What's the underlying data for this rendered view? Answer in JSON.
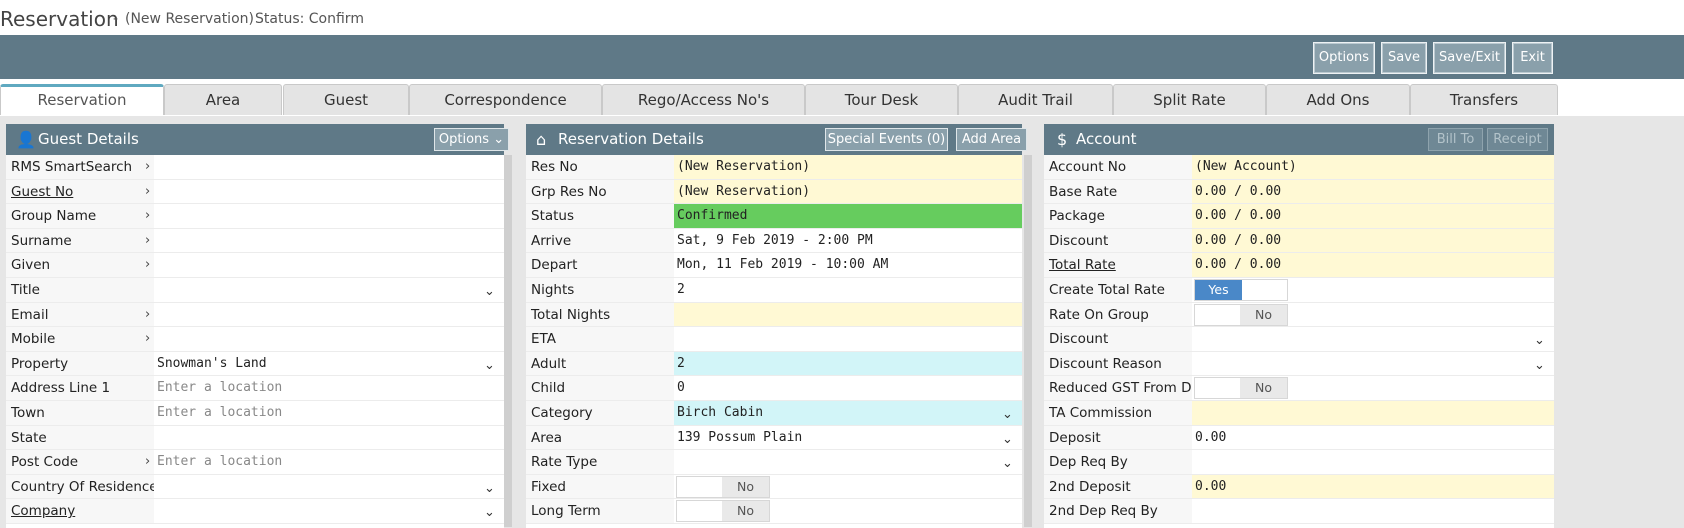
{
  "header": {
    "title": "Reservation",
    "dash": "-",
    "subtitle": "(New Reservation)",
    "status": "Status: Confirm"
  },
  "toolbar": {
    "options": "Options",
    "save": "Save",
    "save_exit": "Save/Exit",
    "exit": "Exit"
  },
  "tabs": [
    "Reservation",
    "Area",
    "Guest",
    "Correspondence",
    "Rego/Access No's",
    "Tour Desk",
    "Audit Trail",
    "Split Rate",
    "Add Ons",
    "Transfers"
  ],
  "guest": {
    "title": "Guest Details",
    "options_label": "Options ⌄",
    "rows": [
      {
        "label": "RMS SmartSearch",
        "value": ""
      },
      {
        "label": "Guest No",
        "value": ""
      },
      {
        "label": "Group Name",
        "value": ""
      },
      {
        "label": "Surname",
        "value": ""
      },
      {
        "label": "Given",
        "value": ""
      },
      {
        "label": "Title",
        "value": ""
      },
      {
        "label": "Email",
        "value": ""
      },
      {
        "label": "Mobile",
        "value": ""
      },
      {
        "label": "Property",
        "value": "Snowman's Land"
      },
      {
        "label": "Address Line 1",
        "value": "Enter a location"
      },
      {
        "label": "Town",
        "value": "Enter a location"
      },
      {
        "label": "State",
        "value": ""
      },
      {
        "label": "Post Code",
        "value": "Enter a location"
      },
      {
        "label": "Country Of Residence",
        "value": ""
      },
      {
        "label": "Company",
        "value": ""
      }
    ]
  },
  "reservation": {
    "title": "Reservation Details",
    "special_events": "Special Events (0)",
    "add_area": "Add Area",
    "rows": [
      {
        "label": "Res No",
        "value": "(New Reservation)"
      },
      {
        "label": "Grp Res No",
        "value": "(New Reservation)"
      },
      {
        "label": "Status",
        "value": "Confirmed"
      },
      {
        "label": "Arrive",
        "value": "Sat, 9 Feb 2019 - 2:00 PM"
      },
      {
        "label": "Depart",
        "value": "Mon, 11 Feb 2019 - 10:00 AM"
      },
      {
        "label": "Nights",
        "value": "2"
      },
      {
        "label": "Total Nights",
        "value": ""
      },
      {
        "label": "ETA",
        "value": ""
      },
      {
        "label": "Adult",
        "value": "2"
      },
      {
        "label": "Child",
        "value": "0"
      },
      {
        "label": "Category",
        "value": "Birch Cabin"
      },
      {
        "label": "Area",
        "value": "139 Possum Plain"
      },
      {
        "label": "Rate Type",
        "value": ""
      },
      {
        "label": "Fixed",
        "value": "No"
      },
      {
        "label": "Long Term",
        "value": "No"
      }
    ]
  },
  "account": {
    "title": "Account",
    "bill_to": "Bill To",
    "receipt": "Receipt",
    "rows": [
      {
        "label": "Account No",
        "value": "(New Account)"
      },
      {
        "label": "Base Rate",
        "value": "0.00 / 0.00"
      },
      {
        "label": "Package",
        "value": "0.00 / 0.00"
      },
      {
        "label": "Discount",
        "value": "0.00 / 0.00"
      },
      {
        "label": "Total Rate",
        "value": "0.00 / 0.00"
      },
      {
        "label": "Create Total Rate",
        "value": "Yes"
      },
      {
        "label": "Rate On Group",
        "value": "No"
      },
      {
        "label": "Discount",
        "value": ""
      },
      {
        "label": "Discount Reason",
        "value": ""
      },
      {
        "label": "Reduced GST From D...",
        "value": "No"
      },
      {
        "label": "TA Commission",
        "value": ""
      },
      {
        "label": "Deposit",
        "value": "0.00"
      },
      {
        "label": "Dep Req By",
        "value": ""
      },
      {
        "label": "2nd Deposit",
        "value": "0.00"
      },
      {
        "label": "2nd Dep Req By",
        "value": ""
      }
    ]
  },
  "colors": {
    "header_bar": "#5f7987",
    "tab_accent": "#5fa9c0",
    "status_green": "#66cc5e",
    "highlight_yellow": "#fff9d4",
    "highlight_cyan": "#d2f5f8",
    "toggle_blue": "#4a88c8"
  }
}
